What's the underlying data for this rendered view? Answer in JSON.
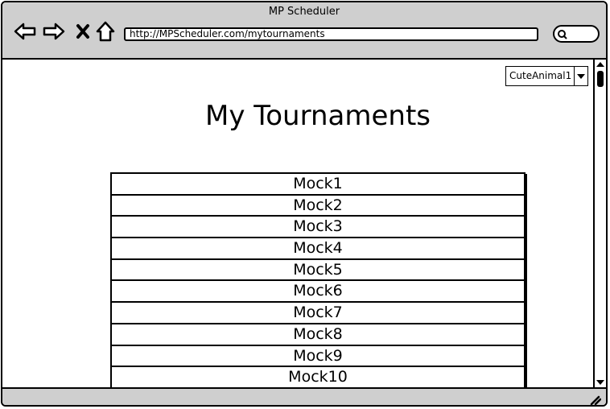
{
  "window": {
    "title": "MP Scheduler",
    "url": "http://MPScheduler.com/mytournaments"
  },
  "icons": {
    "back": "back-arrow-icon",
    "forward": "forward-arrow-icon",
    "stop": "close-icon",
    "home": "home-icon",
    "search": "search-icon",
    "dropdown": "chevron-down-icon",
    "resize": "resize-grip-icon"
  },
  "user_select": {
    "selected": "CuteAnimal1"
  },
  "page": {
    "title": "My Tournaments"
  },
  "tournaments": [
    {
      "name": "Mock1"
    },
    {
      "name": "Mock2"
    },
    {
      "name": "Mock3"
    },
    {
      "name": "Mock4"
    },
    {
      "name": "Mock5"
    },
    {
      "name": "Mock6"
    },
    {
      "name": "Mock7"
    },
    {
      "name": "Mock8"
    },
    {
      "name": "Mock9"
    },
    {
      "name": "Mock10"
    }
  ]
}
